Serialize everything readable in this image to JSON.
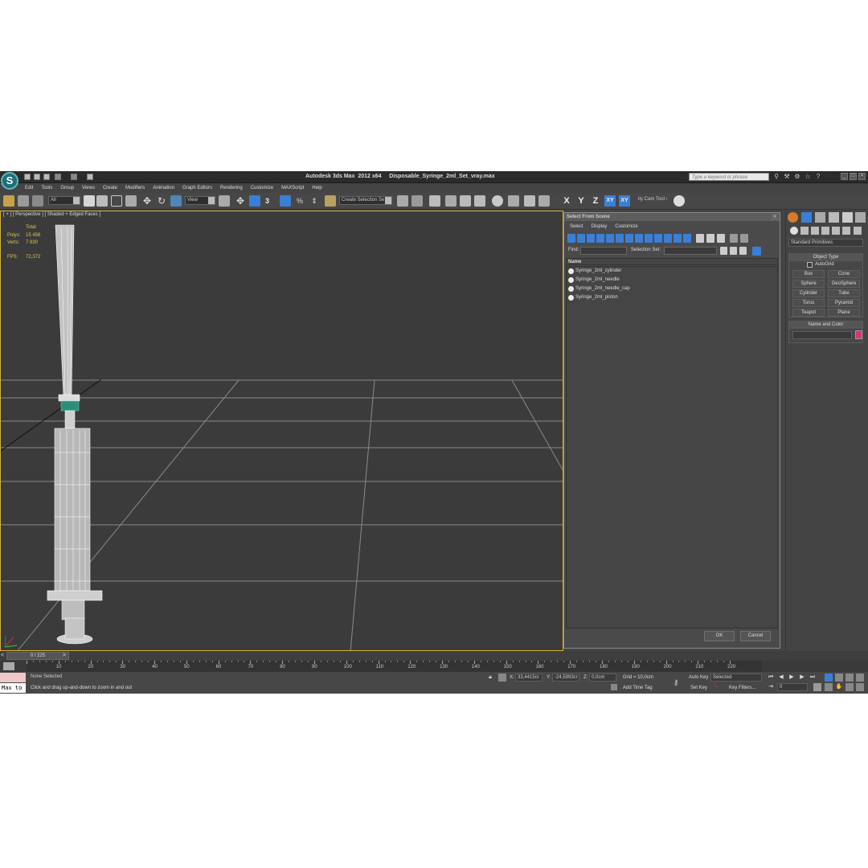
{
  "app": {
    "logo": "S",
    "title": "Autodesk 3ds Max  2012 x64     Disposable_Syringe_2ml_Set_vray.max",
    "search_placeholder": "Type a keyword or phrase"
  },
  "menu": [
    "Edit",
    "Tools",
    "Group",
    "Views",
    "Create",
    "Modifiers",
    "Animation",
    "Graph Editors",
    "Rendering",
    "Customize",
    "MAXScript",
    "Help"
  ],
  "toolbar": {
    "filter": "All",
    "ref_coord": "View",
    "snap_label": "3",
    "selection_set": "Create Selection Se",
    "axes": [
      "X",
      "Y",
      "Z",
      "XY",
      "XY"
    ],
    "city_cam": "ity Cam Tool ‹"
  },
  "viewport": {
    "label": "[ + ] [ Perspective ] [ Shaded + Edged Faces ]",
    "stats": {
      "total_label": "Total",
      "polys_label": "Polys:",
      "polys": "15 456",
      "verts_label": "Verts:",
      "verts": "7 830",
      "fps_label": "FPS:",
      "fps": "72,372"
    }
  },
  "dialog": {
    "title": "Select From Scene",
    "menus": [
      "Select",
      "Display",
      "Customize"
    ],
    "find_label": "Find:",
    "selection_set_label": "Selection Set:",
    "column": "Name",
    "items": [
      "Syringe_2ml_cylinder",
      "Syringe_2ml_needle",
      "Syringe_2ml_needle_cap",
      "Syringe_2ml_piston"
    ],
    "ok": "OK",
    "cancel": "Cancel"
  },
  "command_panel": {
    "category": "Standard Primitives",
    "object_type_header": "Object Type",
    "autogrid": "AutoGrid",
    "primitives": [
      "Box",
      "Cone",
      "Sphere",
      "GeoSphere",
      "Cylinder",
      "Tube",
      "Torus",
      "Pyramid",
      "Teapot",
      "Plane"
    ],
    "name_color_header": "Name and Color",
    "object_color": "#e0307a"
  },
  "timeline": {
    "frame": "0 / 225",
    "ticks": [
      "0",
      "10",
      "20",
      "30",
      "40",
      "50",
      "60",
      "70",
      "80",
      "90",
      "100",
      "110",
      "120",
      "130",
      "140",
      "150",
      "160",
      "170",
      "180",
      "190",
      "200",
      "210",
      "220"
    ]
  },
  "status": {
    "maxscript": "Max to",
    "selection": "None Selected",
    "prompt": "Click and drag up-and-down to zoom in and out",
    "x_label": "X:",
    "x": "33,4415cr",
    "y_label": "Y:",
    "y": "-24,5993cr",
    "z_label": "Z:",
    "z": "0,0cm",
    "grid": "Grid = 10,0cm",
    "add_time_tag": "Add Time Tag",
    "auto_key": "Auto Key",
    "set_key": "Set Key",
    "key_mode": "Selected",
    "key_filters": "Key Filters...",
    "current_frame": "0"
  }
}
